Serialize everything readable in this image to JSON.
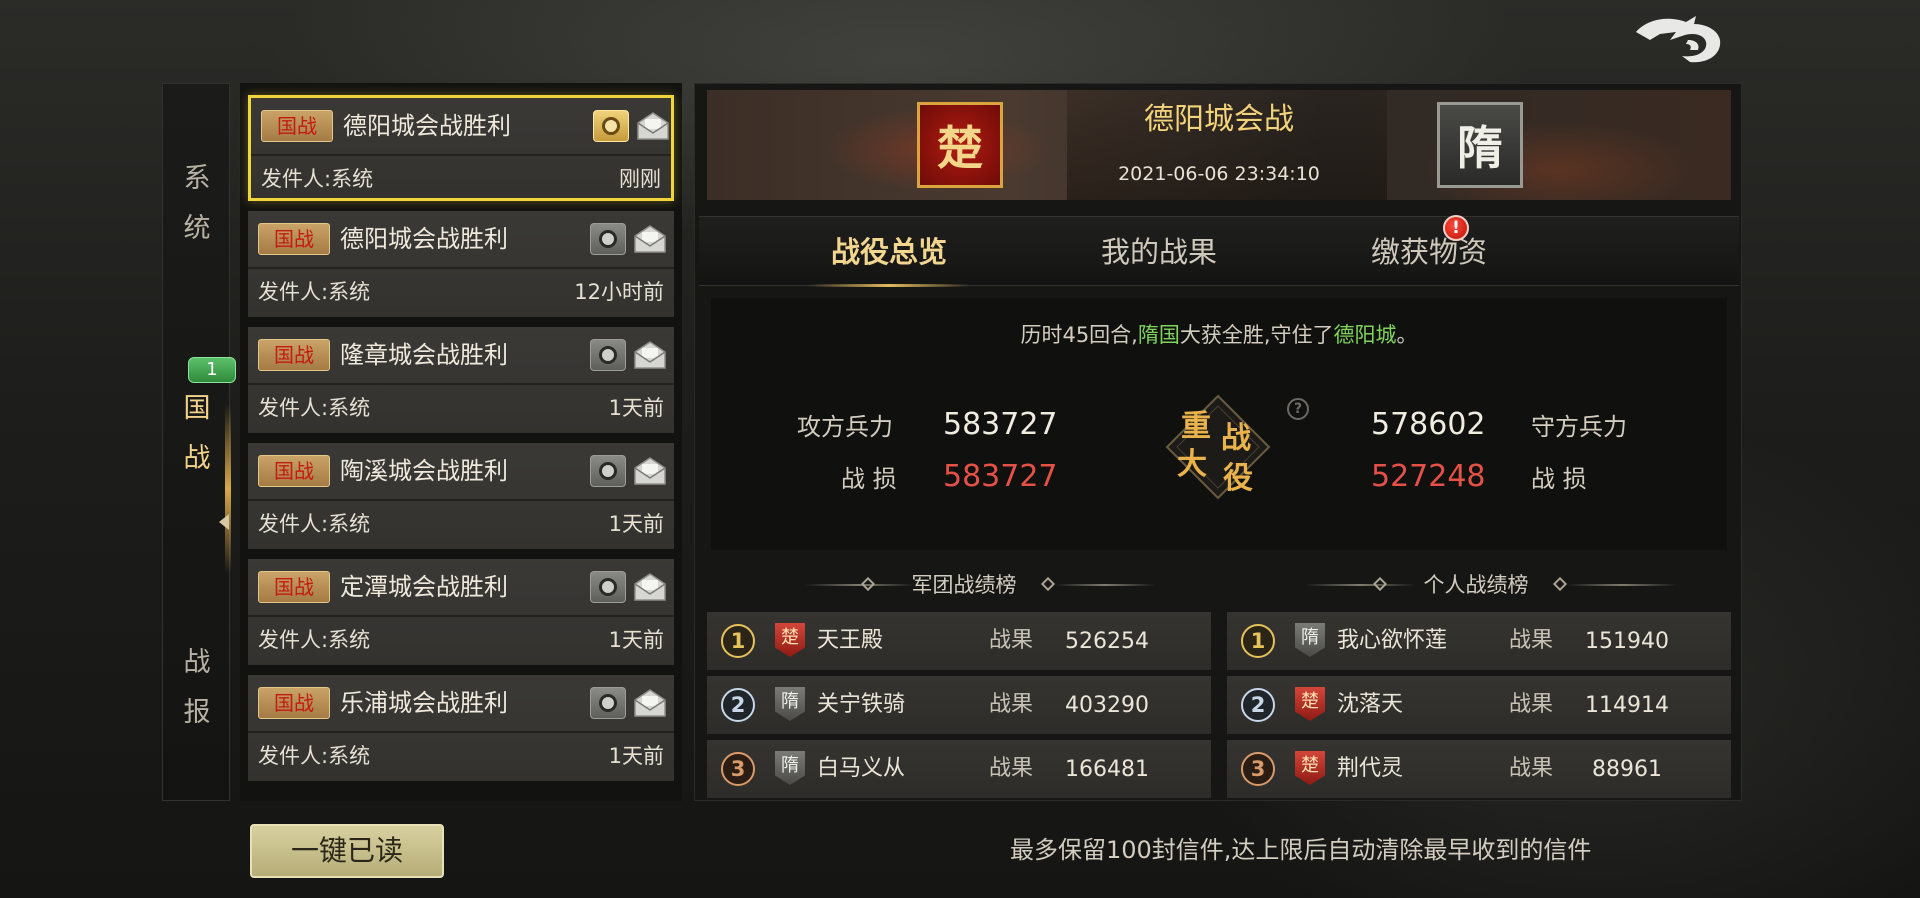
{
  "colors": {
    "accent_gold": "#f0d63a",
    "red_value": "#e65147",
    "green_highlight": "#7fd45b"
  },
  "back_button": {
    "icon": "dragon-back-icon"
  },
  "sidebar": {
    "tabs": [
      {
        "label_1": "系",
        "label_2": "统"
      },
      {
        "label_1": "国",
        "label_2": "战",
        "badge": "1",
        "active": true
      },
      {
        "label_1": "战",
        "label_2": "报"
      }
    ]
  },
  "mails": [
    {
      "tag": "国战",
      "title": "德阳城会战胜利",
      "from": "发件人:系统",
      "time": "刚刚",
      "selected": true
    },
    {
      "tag": "国战",
      "title": "德阳城会战胜利",
      "from": "发件人:系统",
      "time": "12小时前"
    },
    {
      "tag": "国战",
      "title": "隆章城会战胜利",
      "from": "发件人:系统",
      "time": "1天前"
    },
    {
      "tag": "国战",
      "title": "陶溪城会战胜利",
      "from": "发件人:系统",
      "time": "1天前"
    },
    {
      "tag": "国战",
      "title": "定潭城会战胜利",
      "from": "发件人:系统",
      "time": "1天前"
    },
    {
      "tag": "国战",
      "title": "乐浦城会战胜利",
      "from": "发件人:系统",
      "time": "1天前"
    }
  ],
  "detail": {
    "banner": {
      "title": "德阳城会战",
      "datetime": "2021-06-06 23:34:10",
      "attacker_flag": "楚",
      "defender_flag": "隋"
    },
    "tabs": [
      {
        "label": "战役总览",
        "active": true
      },
      {
        "label": "我的战果"
      },
      {
        "label": "缴获物资",
        "alert": "!"
      }
    ],
    "summary": {
      "text_1": "历时45回合,",
      "text_winner": "隋国",
      "text_2": "大获全胜,守住了",
      "text_city": "德阳城",
      "text_3": "。",
      "attacker_troops_label": "攻方兵力",
      "attacker_troops": "583727",
      "attacker_loss_label": "战 损",
      "attacker_loss": "583727",
      "defender_troops_label": "守方兵力",
      "defender_troops": "578602",
      "defender_loss_label": "战 损",
      "defender_loss": "527248",
      "emblem_text": [
        "重",
        "大",
        "战",
        "役"
      ],
      "help": "?"
    },
    "legion_board": {
      "title": "军团战绩榜",
      "rows": [
        {
          "rank": "1",
          "faction": "楚",
          "name": "天王殿",
          "label": "战果",
          "score": "526254"
        },
        {
          "rank": "2",
          "faction": "隋",
          "name": "关宁铁骑",
          "label": "战果",
          "score": "403290"
        },
        {
          "rank": "3",
          "faction": "隋",
          "name": "白马义从",
          "label": "战果",
          "score": "166481"
        }
      ]
    },
    "personal_board": {
      "title": "个人战绩榜",
      "rows": [
        {
          "rank": "1",
          "faction": "隋",
          "name": "我心欲怀莲",
          "label": "战果",
          "score": "151940"
        },
        {
          "rank": "2",
          "faction": "楚",
          "name": "沈落天",
          "label": "战果",
          "score": "114914"
        },
        {
          "rank": "3",
          "faction": "楚",
          "name": "荆代灵",
          "label": "战果",
          "score": "88961"
        }
      ]
    }
  },
  "footer": {
    "read_all": "一键已读",
    "note": "最多保留100封信件,达上限后自动清除最早收到的信件"
  }
}
